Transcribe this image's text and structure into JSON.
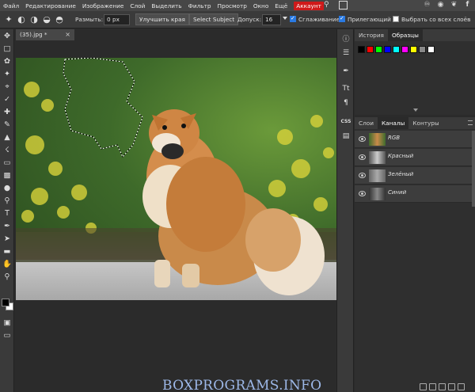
{
  "menu": {
    "items": [
      "Файл",
      "Редактирование",
      "Изображение",
      "Слой",
      "Выделить",
      "Фильтр",
      "Просмотр",
      "Окно",
      "Ещё",
      "Аккаунт"
    ],
    "right_icons": [
      "bell-icon",
      "reddit-icon",
      "twitter-icon",
      "facebook-icon"
    ]
  },
  "options": {
    "size_label": "Размыть:",
    "size_value": "0 px",
    "refine_edge": "Улучшить края",
    "select_subject": "Select Subject",
    "tolerance_label": "Допуск:",
    "tolerance_value": "16",
    "antialias_label": "Сглаживание",
    "antialias_checked": true,
    "contiguous_label": "Прилегающий",
    "contiguous_checked": true,
    "sample_all_label": "Выбрать со всех слоёв",
    "sample_all_checked": false
  },
  "document": {
    "tab_title": "(35).jpg *"
  },
  "history_panel": {
    "tabs": [
      "История",
      "Образцы"
    ],
    "active_tab": "Образцы",
    "swatches": [
      "#000000",
      "#ff0000",
      "#00ff00",
      "#0000ff",
      "#00ffff",
      "#ff00ff",
      "#ffff00",
      "#888888",
      "#ffffff"
    ]
  },
  "layers_panel": {
    "tabs": [
      "Слои",
      "Каналы",
      "Контуры"
    ],
    "active_tab": "Каналы",
    "channels": [
      {
        "name": "RGB",
        "thumb": "color"
      },
      {
        "name": "Красный",
        "thumb": "red"
      },
      {
        "name": "Зелёный",
        "thumb": "green"
      },
      {
        "name": "Синий",
        "thumb": "blue"
      }
    ]
  },
  "watermark": "BOXPROGRAMS.INFO"
}
